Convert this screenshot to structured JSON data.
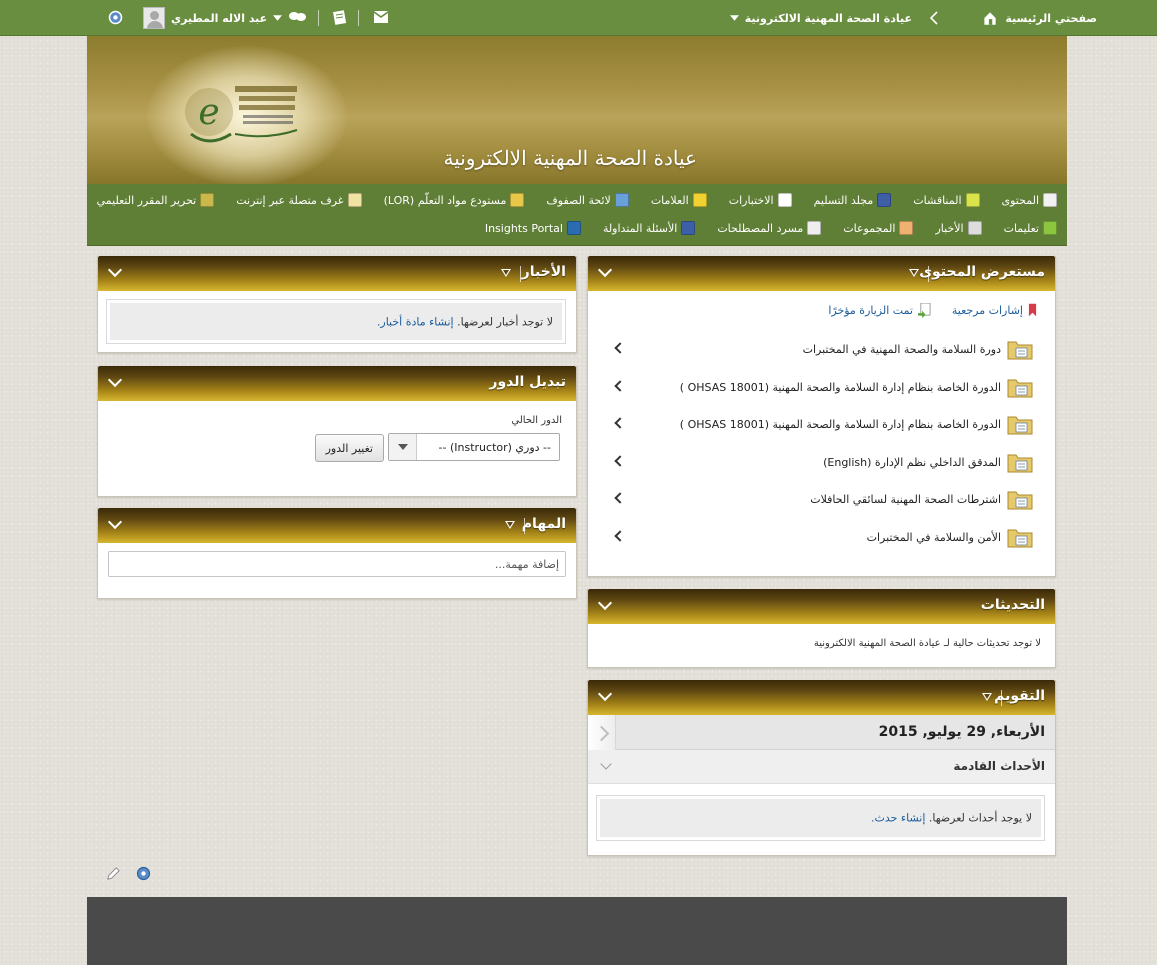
{
  "topbar": {
    "home_label": "صفحتي الرئيسية",
    "course_title": "عيادة الصحة المهنية الالكترونية",
    "user_name": "عبد الاله المطيري"
  },
  "banner": {
    "site_title": "عيادة الصحة المهنية الالكترونية"
  },
  "course_menu": {
    "row1": [
      {
        "label": "المحتوى",
        "icon": "book-icon",
        "color": "#f2f2f2"
      },
      {
        "label": "المناقشات",
        "icon": "discussion-icon",
        "color": "#d9e44b"
      },
      {
        "label": "مجلد التسليم",
        "icon": "dropbox-icon",
        "color": "#3c5fa8"
      },
      {
        "label": "الاختبارات",
        "icon": "quiz-icon",
        "color": "#ffffff"
      },
      {
        "label": "العلامات",
        "icon": "grades-icon",
        "color": "#f2d230"
      },
      {
        "label": "لائحة الصفوف",
        "icon": "classlist-icon",
        "color": "#6aa0d8"
      },
      {
        "label": "مستودع مواد التعلّم (LOR)",
        "icon": "repository-icon",
        "color": "#e8c84a"
      },
      {
        "label": "غرف متصلة عبر إنترنت",
        "icon": "online-rooms-icon",
        "color": "#f0e2a0"
      },
      {
        "label": "تحرير المقرر التعليمي",
        "icon": "edit-course-icon",
        "color": "#c9b94a"
      }
    ],
    "row2": [
      {
        "label": "تعليمات",
        "icon": "help-icon",
        "color": "#8cc63f"
      },
      {
        "label": "الأخبار",
        "icon": "news-icon",
        "color": "#dddddd"
      },
      {
        "label": "المجموعات",
        "icon": "groups-icon",
        "color": "#f0b070"
      },
      {
        "label": "مسرد المصطلحات",
        "icon": "glossary-icon",
        "color": "#eeeeee"
      },
      {
        "label": "الأسئلة المتداولة",
        "icon": "faq-icon",
        "color": "#3c5fa8"
      },
      {
        "label": "Insights Portal",
        "icon": "insights-icon",
        "color": "#2b6cb0"
      }
    ]
  },
  "content_browser": {
    "title": "مستعرض المحتوى",
    "bookmarks_label": "إشارات مرجعية",
    "recent_label": "تمت الزيارة مؤخرًا",
    "items": [
      {
        "label": "دورة السلامة والصحة المهنية في المختبرات"
      },
      {
        "label": "الدورة الخاصة بنظام إدارة السلامة والصحة المهنية (OHSAS 18001 )"
      },
      {
        "label": "الدورة الخاصة بنظام إدارة السلامة والصحة المهنية (OHSAS 18001 )"
      },
      {
        "label": "المدقق الداخلي نظم الإدارة (English)"
      },
      {
        "label": "اشترطات الصحة المهنية لسائقي الحافلات"
      },
      {
        "label": "الأمن والسلامة في المختبرات"
      }
    ]
  },
  "updates": {
    "title": "التحديثات",
    "message": "لا توجد تحديثات حالية لـ عيادة الصحة المهنية الالكترونية"
  },
  "calendar": {
    "title": "التقويم",
    "date": "الأربعاء, 29 يوليو, 2015",
    "upcoming_title": "الأحداث القادمة",
    "empty_text": "لا يوجد أحداث لعرضها.",
    "create_link": "إنشاء حدث."
  },
  "news": {
    "title": "الأخبار",
    "empty_text": "لا توجد أخبار لعرضها.",
    "create_link": "إنشاء مادة أخبار."
  },
  "role_switch": {
    "title": "تبديل الدور",
    "current_role_label": "الدور الحالي",
    "selected_role": "-- دوري (Instructor) --",
    "change_button": "تغيير الدور"
  },
  "tasks": {
    "title": "المهام",
    "placeholder": "إضافة مهمة..."
  },
  "colors": {
    "topbar": "#6a8e3f",
    "course_menu": "#5f7e36",
    "module_header_dark": "#3a2a08",
    "module_header_light": "#d6b630",
    "link": "#1a5b9c"
  }
}
